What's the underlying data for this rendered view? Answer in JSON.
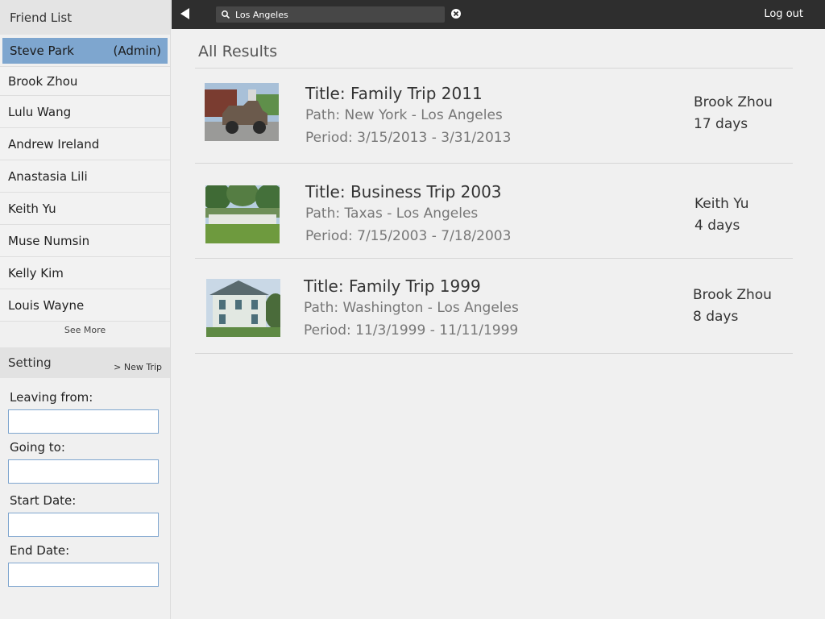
{
  "sidebar": {
    "friend_list_title": "Friend List",
    "current_user": {
      "name": "Steve Park",
      "role": "(Admin)"
    },
    "friends": [
      "Brook Zhou",
      "Lulu Wang",
      "Andrew Ireland",
      "Anastasia Lili",
      "Keith Yu",
      "Muse Numsin",
      "Kelly Kim",
      "Louis Wayne"
    ],
    "see_more": "See More",
    "setting_title": "Setting",
    "new_trip": "> New Trip",
    "form": {
      "leaving_from_label": "Leaving from:",
      "leaving_from_value": "",
      "going_to_label": "Going to:",
      "going_to_value": "",
      "start_date_label": "Start Date:",
      "start_date_value": "",
      "end_date_label": "End Date:",
      "end_date_value": ""
    }
  },
  "topbar": {
    "search_value": "Los Angeles",
    "logout": "Log out"
  },
  "main": {
    "title": "All Results",
    "results": [
      {
        "title": "Title: Family Trip 2011",
        "path": "Path: New York - Los Angeles",
        "period": "Period: 3/15/2013 - 3/31/2013",
        "user": "Brook Zhou",
        "days": "17 days",
        "thumb_kind": "car"
      },
      {
        "title": "Title: Business Trip 2003",
        "path": "Path: Taxas - Los Angeles",
        "period": "Period: 7/15/2003 - 7/18/2003",
        "user": "Keith Yu",
        "days": "4 days",
        "thumb_kind": "park"
      },
      {
        "title": "Title: Family Trip 1999",
        "path": "Path: Washington - Los Angeles",
        "period": "Period: 11/3/1999 - 11/11/1999",
        "user": "Brook Zhou",
        "days": "8 days",
        "thumb_kind": "house"
      }
    ]
  },
  "colors": {
    "selected_bg": "#7ea6cf",
    "topbar_bg": "#2e2e2e",
    "input_border": "#7fa6cf"
  }
}
